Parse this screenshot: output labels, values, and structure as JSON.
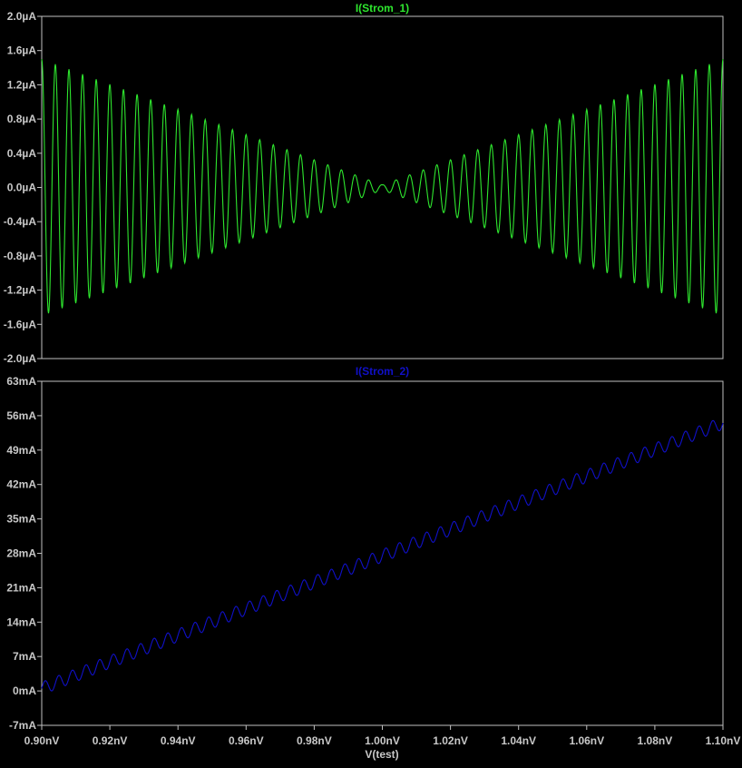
{
  "chart_data": [
    {
      "type": "line",
      "title": "I(Strom_1)",
      "color": "#2ee62e",
      "xlabel": "V(test)",
      "xlim": [
        0.9,
        1.1
      ],
      "ylim": [
        -2.0,
        2.0
      ],
      "grid": false,
      "yticks": [
        "2.0µA",
        "1.6µA",
        "1.2µA",
        "0.8µA",
        "0.4µA",
        "0.0µA",
        "-0.4µA",
        "-0.8µA",
        "-1.2µA",
        "-1.6µA",
        "-2.0µA"
      ],
      "ytick_values": [
        2.0,
        1.6,
        1.2,
        0.8,
        0.4,
        0.0,
        -0.4,
        -0.8,
        -1.2,
        -1.6,
        -2.0
      ],
      "series": [
        {
          "name": "I(Strom_1)",
          "unit": "µA",
          "model": "envelope(x)*cos(2*pi*cycles*(x-0.90)/0.20)",
          "envelope_peak_at_edges": 1.5,
          "envelope_min_at_center": 0.03,
          "cycles": 50
        }
      ]
    },
    {
      "type": "line",
      "title": "I(Strom_2)",
      "color": "#1010c8",
      "xlabel": "V(test)",
      "xlim": [
        0.9,
        1.1
      ],
      "ylim": [
        -7,
        63
      ],
      "grid": false,
      "yticks": [
        "63mA",
        "56mA",
        "49mA",
        "42mA",
        "35mA",
        "28mA",
        "21mA",
        "14mA",
        "7mA",
        "0mA",
        "-7mA"
      ],
      "ytick_values": [
        63,
        56,
        49,
        42,
        35,
        28,
        21,
        14,
        7,
        0,
        -7
      ],
      "series": [
        {
          "name": "I(Strom_2)",
          "unit": "mA",
          "model": "start + (end-start)*(x-0.90)/0.20 + ripple*sin(2*pi*cycles*(x-0.90)/0.20)",
          "start": 0.5,
          "end": 54.5,
          "ripple": 1.3,
          "cycles": 50
        }
      ]
    }
  ],
  "xticks": [
    "0.90nV",
    "0.92nV",
    "0.94nV",
    "0.96nV",
    "0.98nV",
    "1.00nV",
    "1.02nV",
    "1.04nV",
    "1.06nV",
    "1.08nV",
    "1.10nV"
  ],
  "xlabel": "V(test)"
}
